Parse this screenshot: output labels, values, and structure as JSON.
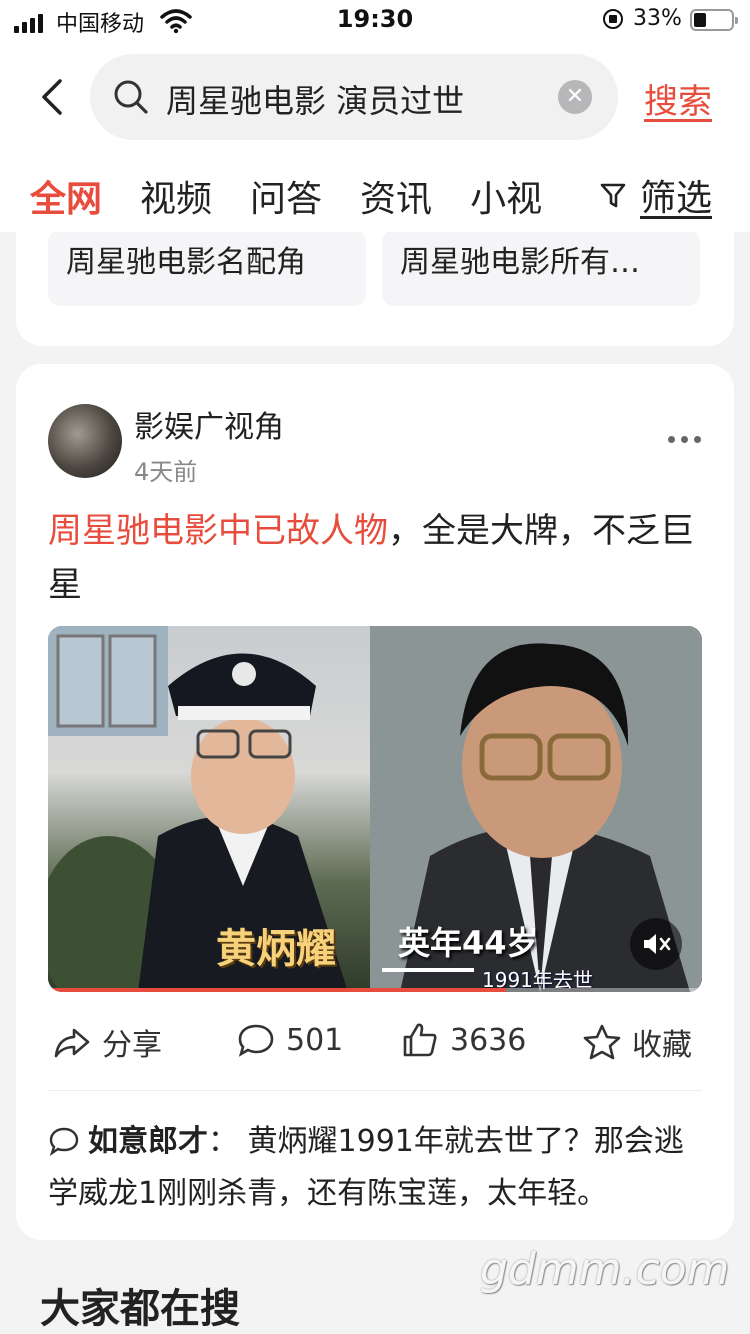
{
  "status_bar": {
    "carrier": "中国移动",
    "time": "19:30",
    "battery_pct": "33%",
    "battery_level": 0.33
  },
  "search": {
    "query": "周星驰电影 演员过世",
    "clear_icon": "clear-icon",
    "search_label": "搜索"
  },
  "tabs": [
    {
      "label": "全网",
      "active": true
    },
    {
      "label": "视频",
      "active": false
    },
    {
      "label": "问答",
      "active": false
    },
    {
      "label": "资讯",
      "active": false
    },
    {
      "label": "小视",
      "active": false
    }
  ],
  "filter_label": "筛选",
  "related": {
    "items": [
      "周星驰电影名配角",
      "周星驰电影所有…"
    ]
  },
  "post": {
    "author": "影娱广视角",
    "time_ago": "4天前",
    "title_highlight": "周星驰电影中已故人物",
    "title_rest": "，全是大牌，不乏巨星",
    "video": {
      "caption_left": "黄炳耀",
      "caption_right": "英年44岁",
      "caption_sub": "1991年去世",
      "progress": 0.7
    },
    "actions": {
      "share": "分享",
      "comments": "501",
      "likes": "3636",
      "favorite": "收藏"
    },
    "top_comment": {
      "name": "如意郎才",
      "sep": "：",
      "text": "黄炳耀1991年就去世了？那会逃学威龙1刚刚杀青，还有陈宝莲，太年轻。"
    }
  },
  "section_title": "大家都在搜",
  "watermark": "gdmm.com",
  "colors": {
    "accent": "#e84c3d",
    "background": "#f3f3f4"
  }
}
